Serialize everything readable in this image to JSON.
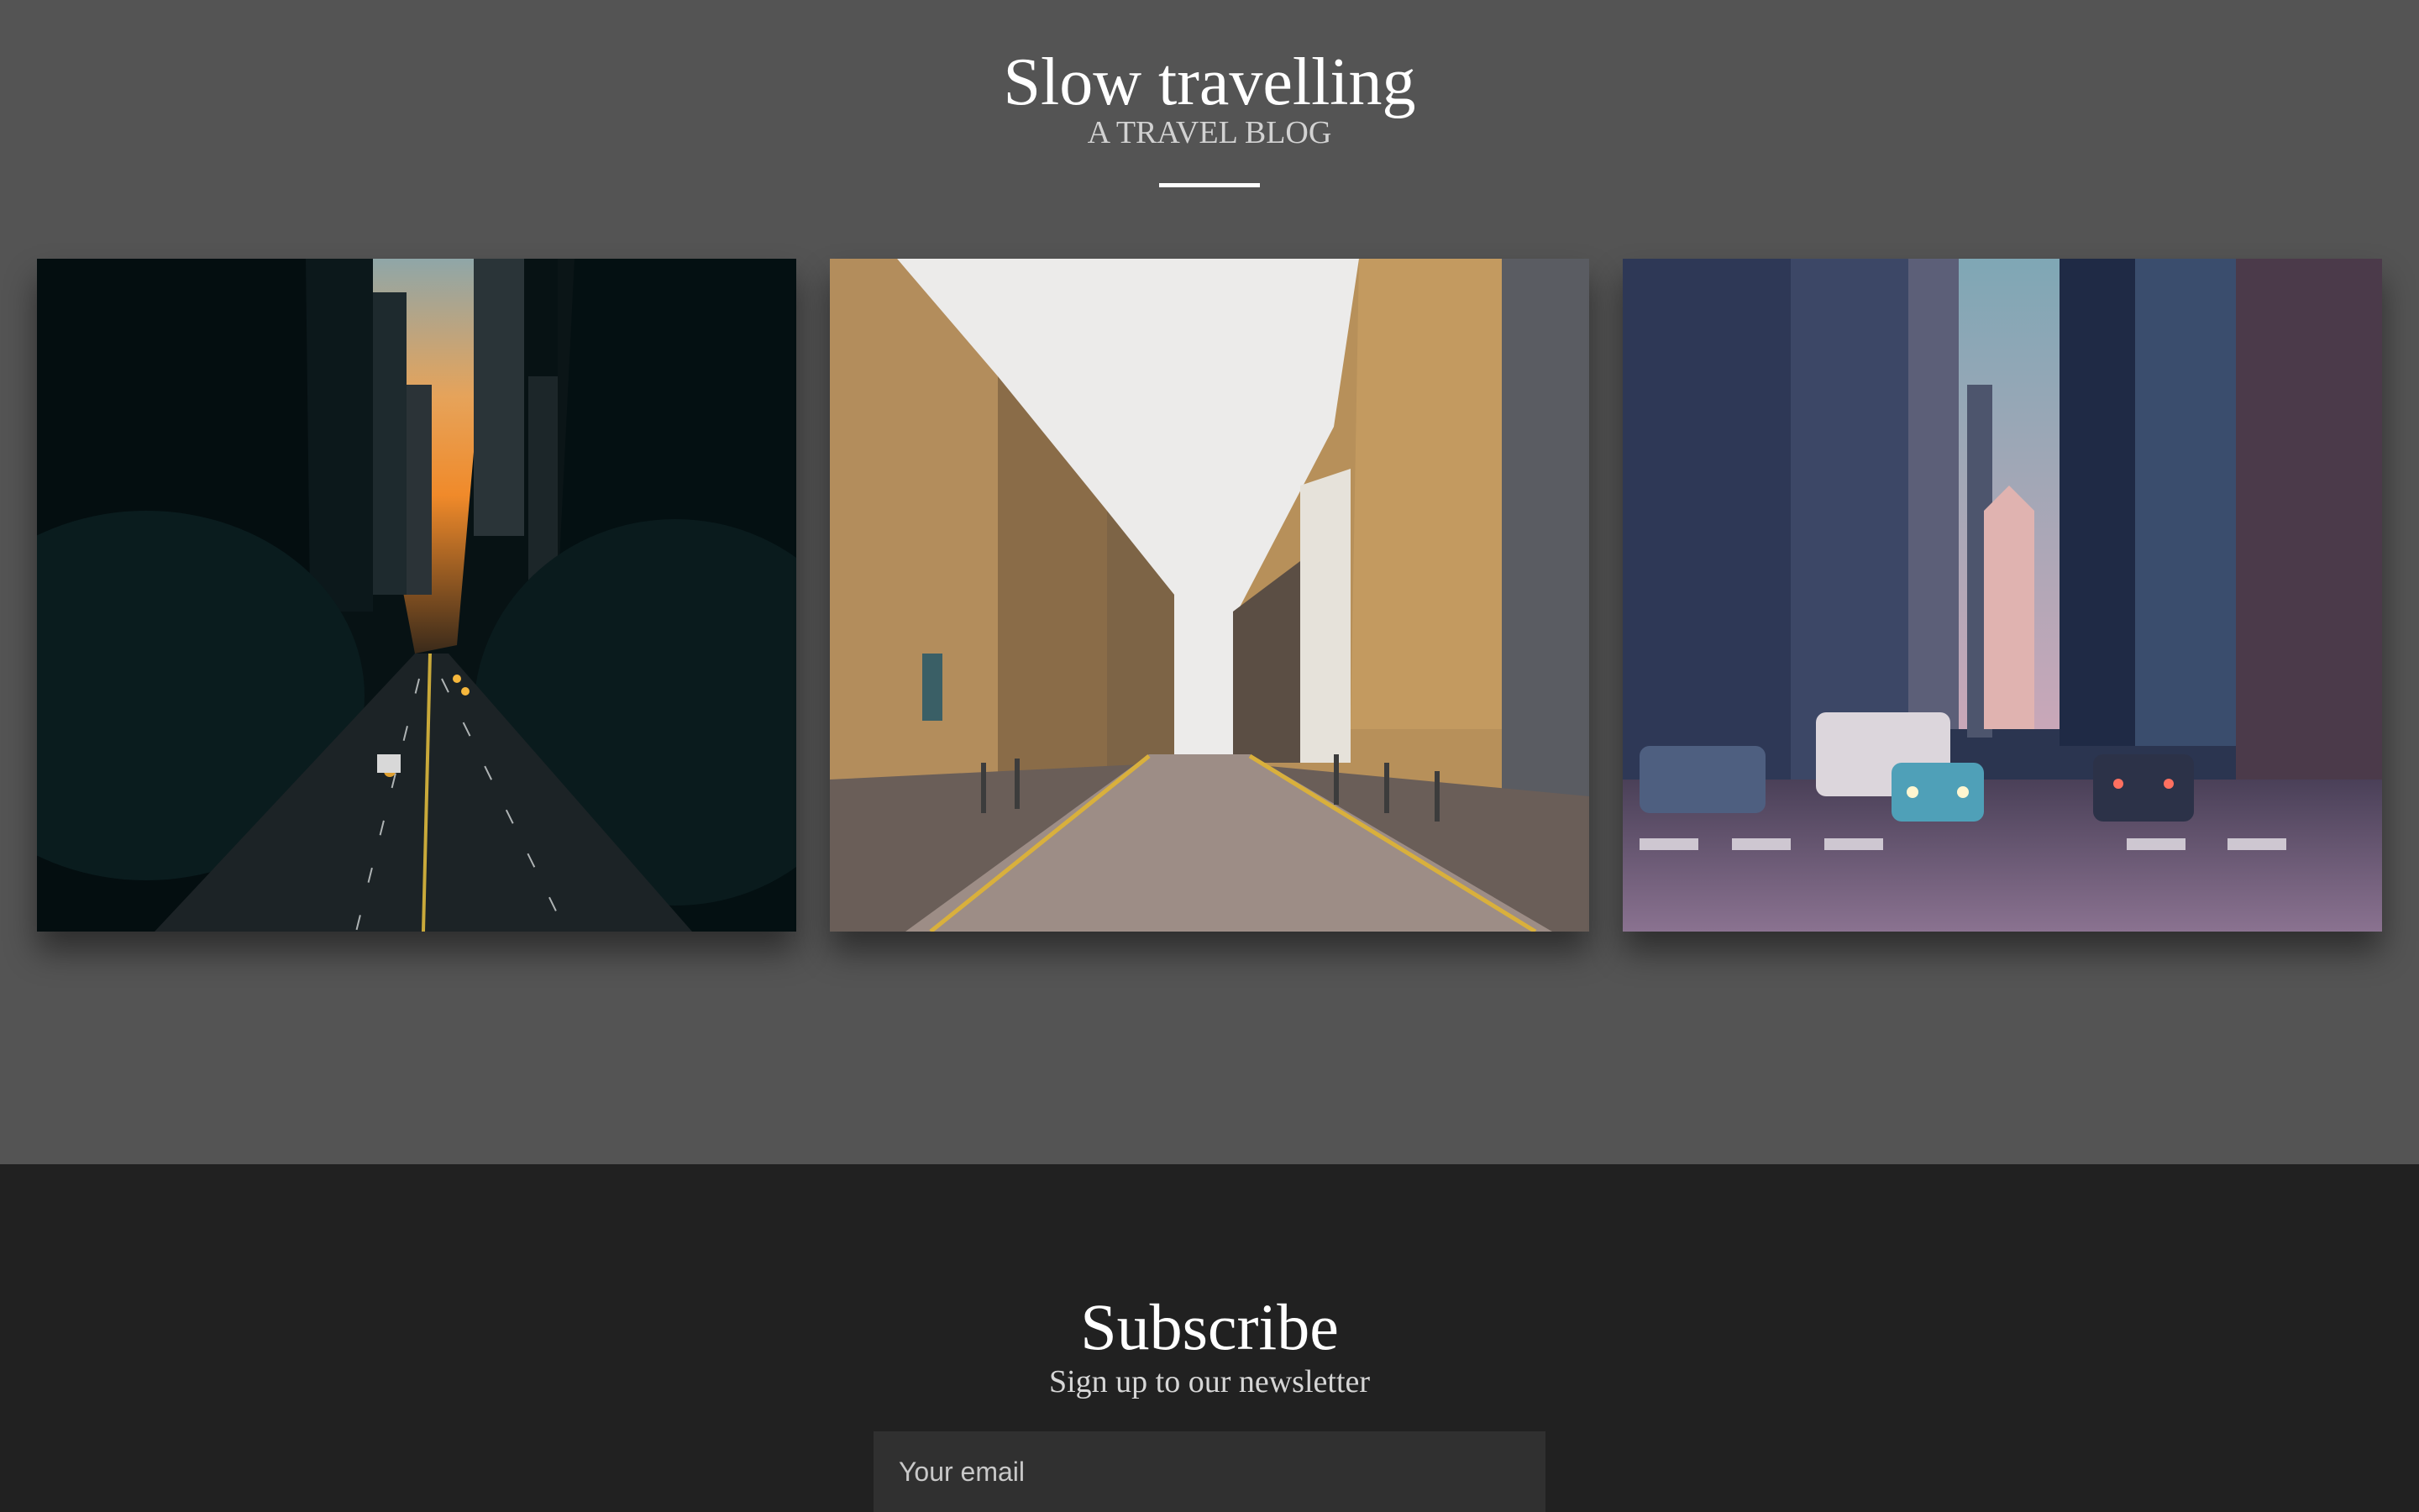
{
  "header": {
    "title": "Slow travelling",
    "subtitle": "A TRAVEL BLOG"
  },
  "gallery": {
    "photos": [
      {
        "alt": "City avenue at dusk with skyscrapers"
      },
      {
        "alt": "Cobblestone street between old buildings"
      },
      {
        "alt": "Downtown street with traffic and towers"
      }
    ]
  },
  "subscribe": {
    "title": "Subscribe",
    "subtitle": "Sign up to our newsletter",
    "email_placeholder": "Your email"
  },
  "colors": {
    "page_bg": "#545454",
    "footer_bg": "#212121",
    "input_bg": "#303030"
  }
}
